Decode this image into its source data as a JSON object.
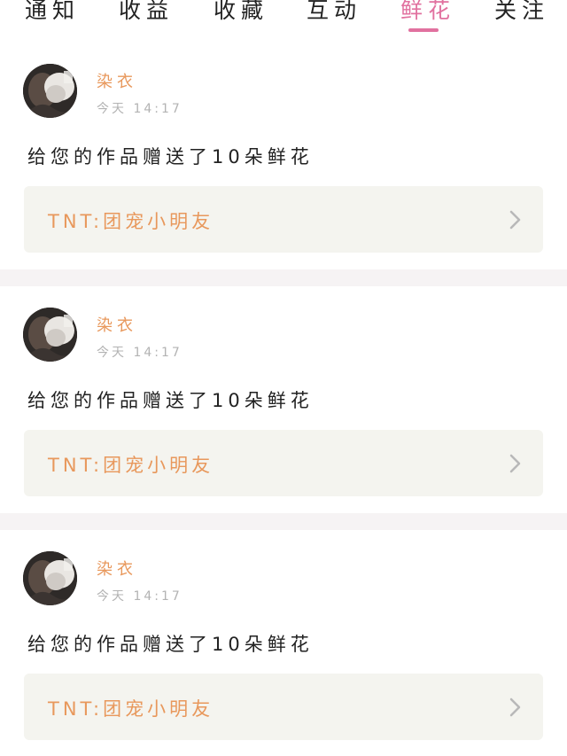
{
  "tabs": [
    {
      "label": "通知",
      "active": false
    },
    {
      "label": "收益",
      "active": false
    },
    {
      "label": "收藏",
      "active": false
    },
    {
      "label": "互动",
      "active": false
    },
    {
      "label": "鲜花",
      "active": true
    },
    {
      "label": "关注",
      "active": false
    }
  ],
  "colors": {
    "accent": "#e1719f",
    "sender_name": "#e8985c",
    "work_title": "#e8985c",
    "card_background": "#f4f4ef",
    "separator": "#f6f3f4"
  },
  "notifications": [
    {
      "avatar_icon": "user-avatar",
      "sender": "染衣",
      "time": "今天 14:17",
      "message": "给您的作品赠送了10朵鲜花",
      "work_title": "TNT:团宠小明友",
      "chevron_icon": "chevron-right-icon"
    },
    {
      "avatar_icon": "user-avatar",
      "sender": "染衣",
      "time": "今天 14:17",
      "message": "给您的作品赠送了10朵鲜花",
      "work_title": "TNT:团宠小明友",
      "chevron_icon": "chevron-right-icon"
    },
    {
      "avatar_icon": "user-avatar",
      "sender": "染衣",
      "time": "今天 14:17",
      "message": "给您的作品赠送了10朵鲜花",
      "work_title": "TNT:团宠小明友",
      "chevron_icon": "chevron-right-icon"
    }
  ]
}
